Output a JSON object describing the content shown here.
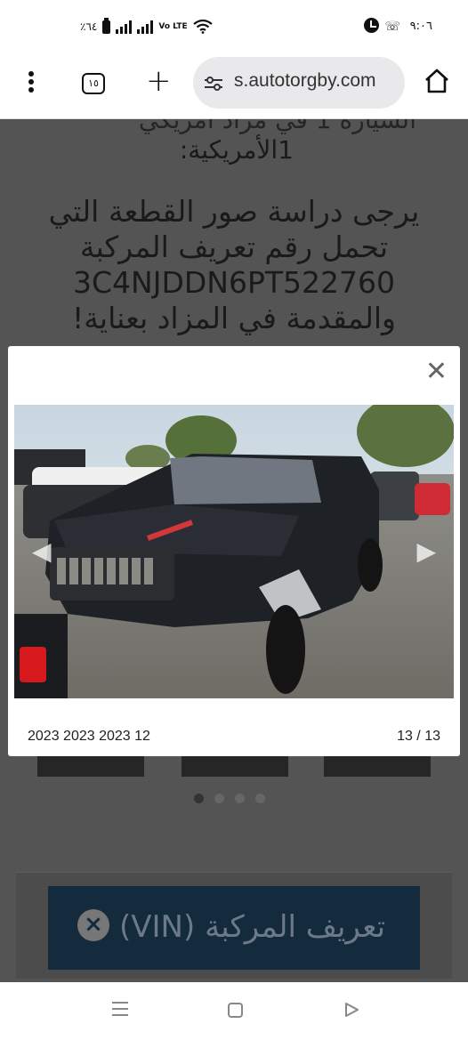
{
  "status_bar": {
    "time": "٩:٠٦",
    "battery": "٪٦٤",
    "volte": "Vo LTE"
  },
  "browser": {
    "tab_count": "١٥",
    "url": "s.autotorgby.com"
  },
  "background": {
    "heading_partial": "السيارة 1 في مزاد امريكي",
    "heading_line": "1الأمريكية:",
    "paragraph": "يرجى دراسة صور القطعة التي تحمل رقم تعريف المركبة 3C4NJDDN6PT522760 والمقدمة في المزاد بعناية!",
    "vin_button_label": "تعريف المركبة (VIN)"
  },
  "modal": {
    "caption": "2023 2023 2023 12",
    "counter": "13 / 13"
  },
  "colors": {
    "overlay": "#545454",
    "vin_button": "#142b3e",
    "taillight_red": "#d6191d"
  },
  "icons": [
    "menu-icon",
    "tabs-icon",
    "plus-icon",
    "tune-icon",
    "home-icon",
    "close-icon",
    "chevron-left-icon",
    "chevron-right-icon",
    "nav-recents-icon",
    "nav-home-icon",
    "nav-back-icon",
    "wifi-icon",
    "signal-icon",
    "battery-icon",
    "alarm-icon",
    "call-icon"
  ]
}
